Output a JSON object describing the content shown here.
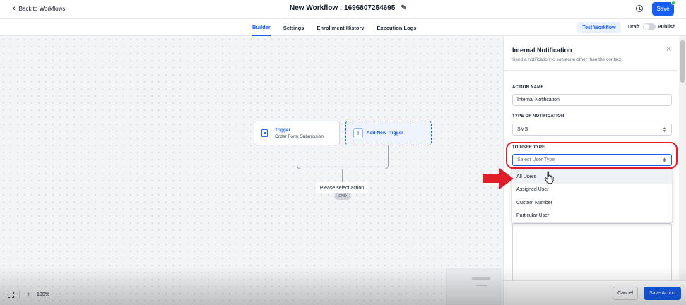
{
  "header": {
    "back_label": "Back to Workflows",
    "title": "New Workflow : 1696807254695",
    "save_label": "Save"
  },
  "tabs": [
    "Builder",
    "Settings",
    "Enrollment History",
    "Execution Logs"
  ],
  "active_tab": "Builder",
  "toolbar": {
    "test_label": "Test Workflow",
    "draft_label": "Draft",
    "publish_label": "Publish"
  },
  "canvas": {
    "trigger": {
      "title": "Trigger",
      "subtitle": "Order Form Submission"
    },
    "add_trigger_label": "Add New Trigger",
    "tooltip": "Please select action",
    "end_label": "END",
    "zoom": "100%"
  },
  "panel": {
    "title": "Internal Notification",
    "subtitle": "Send a notification to someone other than the contact",
    "action_name_label": "ACTION NAME",
    "action_name_value": "Internal Notification",
    "notification_type_label": "TYPE OF NOTIFICATION",
    "notification_type_value": "SMS",
    "user_type_label": "TO USER TYPE",
    "user_type_placeholder": "Select User Type",
    "user_type_options": [
      "All Users",
      "Assigned User",
      "Custom Number",
      "Particular User"
    ],
    "hovered_option": "All Users",
    "cancel_label": "Cancel",
    "save_action_label": "Save Action"
  },
  "colors": {
    "accent": "#155eef",
    "highlight": "#e11d2a",
    "status_dot": "#22c55e"
  },
  "icons": [
    "chevron-left-icon",
    "pencil-icon",
    "history-icon",
    "clipboard-icon",
    "plus-icon",
    "close-icon",
    "fit-view-icon",
    "zoom-in-icon",
    "zoom-out-icon",
    "red-arrow-icon",
    "hand-cursor-icon"
  ]
}
